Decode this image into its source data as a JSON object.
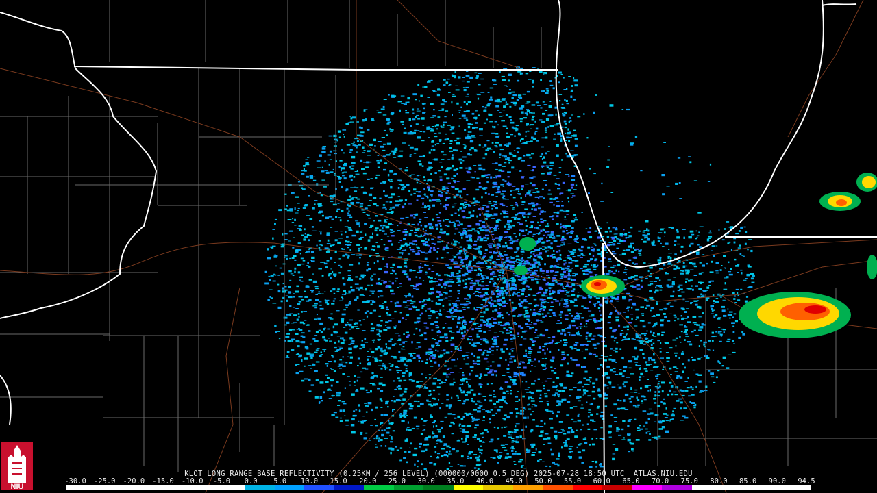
{
  "product": {
    "caption": "KLOT LONG RANGE BASE REFLECTIVITY (0.25KM / 256 LEVEL) (000000/0000 0.5 DEG) 2025-07-28 18:50 UTC  ATLAS.NIU.EDU"
  },
  "logo": {
    "text": "NIU",
    "color": "#c8102e"
  },
  "legend": {
    "ticks": [
      "-30.0",
      "-25.0",
      "-20.0",
      "-15.0",
      "-10.0",
      "-5.0",
      "0.0",
      "5.0",
      "10.0",
      "15.0",
      "20.0",
      "25.0",
      "30.0",
      "35.0",
      "40.0",
      "45.0",
      "50.0",
      "55.0",
      "60.0",
      "65.0",
      "70.0",
      "75.0",
      "80.0",
      "85.0",
      "90.0",
      "94.5"
    ],
    "colors": [
      "#ffffff",
      "#ffffff",
      "#ffffff",
      "#ffffff",
      "#ffffff",
      "#ffffff",
      "#00b4e6",
      "#00a0ff",
      "#2050ff",
      "#0018c8",
      "#00cc44",
      "#00a030",
      "#008020",
      "#ffff00",
      "#e6c800",
      "#ffa000",
      "#ff5000",
      "#ff0000",
      "#c80000",
      "#ff00ff",
      "#b000e0",
      "#ffffff",
      "#ffffff",
      "#ffffff",
      "#ffffff"
    ]
  },
  "palette": {
    "state_border": "#ffffff",
    "county_border": "#6a6a6a",
    "roads": "#7a3a1e"
  }
}
